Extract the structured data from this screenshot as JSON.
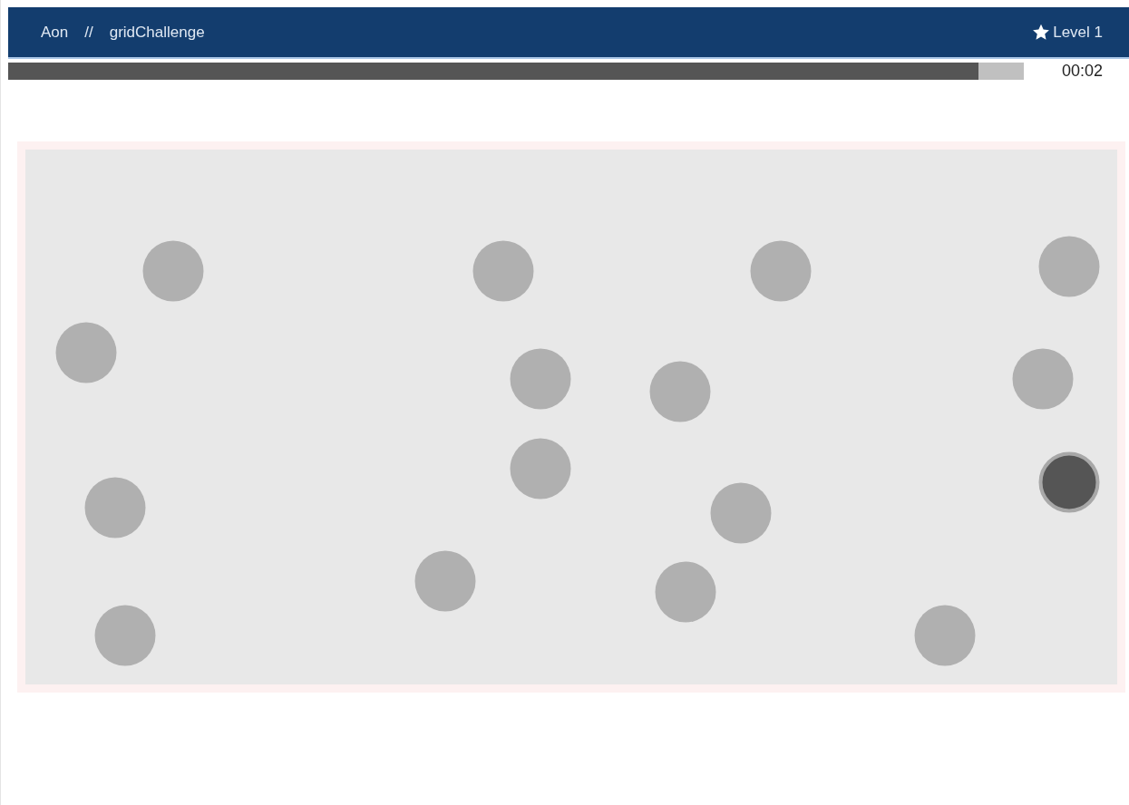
{
  "header": {
    "brand": "Aon",
    "separator": "//",
    "title": "gridChallenge",
    "level": "Level 1"
  },
  "progress": {
    "level": 0.955,
    "time": "00:02"
  },
  "dots": [
    {
      "selected": false
    },
    {
      "selected": false
    },
    {
      "selected": false
    },
    {
      "selected": false
    },
    {
      "selected": false
    },
    {
      "selected": false
    },
    {
      "selected": false
    },
    {
      "selected": false
    },
    {
      "selected": false
    },
    {
      "selected": true
    },
    {
      "selected": false
    },
    {
      "selected": false
    },
    {
      "selected": false
    },
    {
      "selected": false
    },
    {
      "selected": false
    },
    {
      "selected": false
    }
  ]
}
